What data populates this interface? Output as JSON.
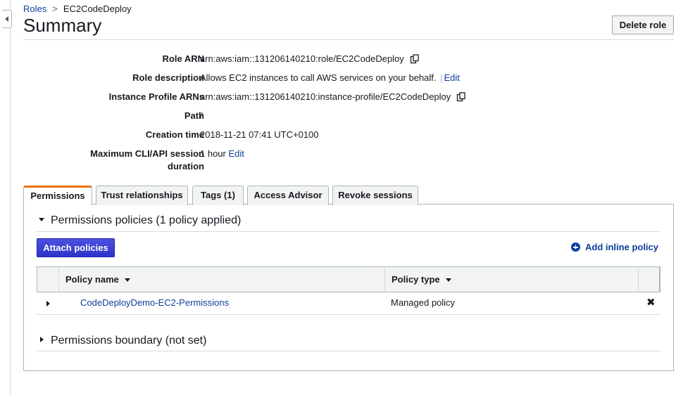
{
  "breadcrumb": {
    "root": "Roles",
    "separator": ">",
    "current": "EC2CodeDeploy"
  },
  "page_title": "Summary",
  "delete_button": "Delete role",
  "summary": {
    "role_arn": {
      "label": "Role ARN",
      "value": "arn:aws:iam::131206140210:role/EC2CodeDeploy"
    },
    "role_description": {
      "label": "Role description",
      "value": "Allows EC2 instances to call AWS services on your behalf.",
      "separator": "|",
      "edit": "Edit"
    },
    "instance_profile_arns": {
      "label": "Instance Profile ARNs",
      "value": "arn:aws:iam::131206140210:instance-profile/EC2CodeDeploy"
    },
    "path": {
      "label": "Path",
      "value": "/"
    },
    "creation_time": {
      "label": "Creation time",
      "value": "2018-11-21 07:41 UTC+0100"
    },
    "max_session": {
      "label_line1": "Maximum CLI/API session",
      "label_line2": "duration",
      "value": "1 hour",
      "edit": "Edit"
    }
  },
  "tabs": [
    {
      "label": "Permissions",
      "active": true
    },
    {
      "label": "Trust relationships",
      "active": false
    },
    {
      "label": "Tags (1)",
      "active": false
    },
    {
      "label": "Access Advisor",
      "active": false
    },
    {
      "label": "Revoke sessions",
      "active": false
    }
  ],
  "permissions": {
    "policies_heading": "Permissions policies (1 policy applied)",
    "attach_button": "Attach policies",
    "add_inline": "Add inline policy",
    "table": {
      "columns": [
        "Policy name",
        "Policy type"
      ],
      "rows": [
        {
          "name": "CodeDeployDemo-EC2-Permissions",
          "type": "Managed policy"
        }
      ]
    },
    "boundary_heading": "Permissions boundary (not set)"
  },
  "icons": {
    "copy": "copy-icon",
    "remove": "close-icon",
    "add": "plus-circle-icon",
    "collapse": "chevron-left-icon"
  },
  "colors": {
    "link": "#0c3e9c",
    "primary_button": "#3b3fd8",
    "active_tab_accent": "#ec7211"
  }
}
